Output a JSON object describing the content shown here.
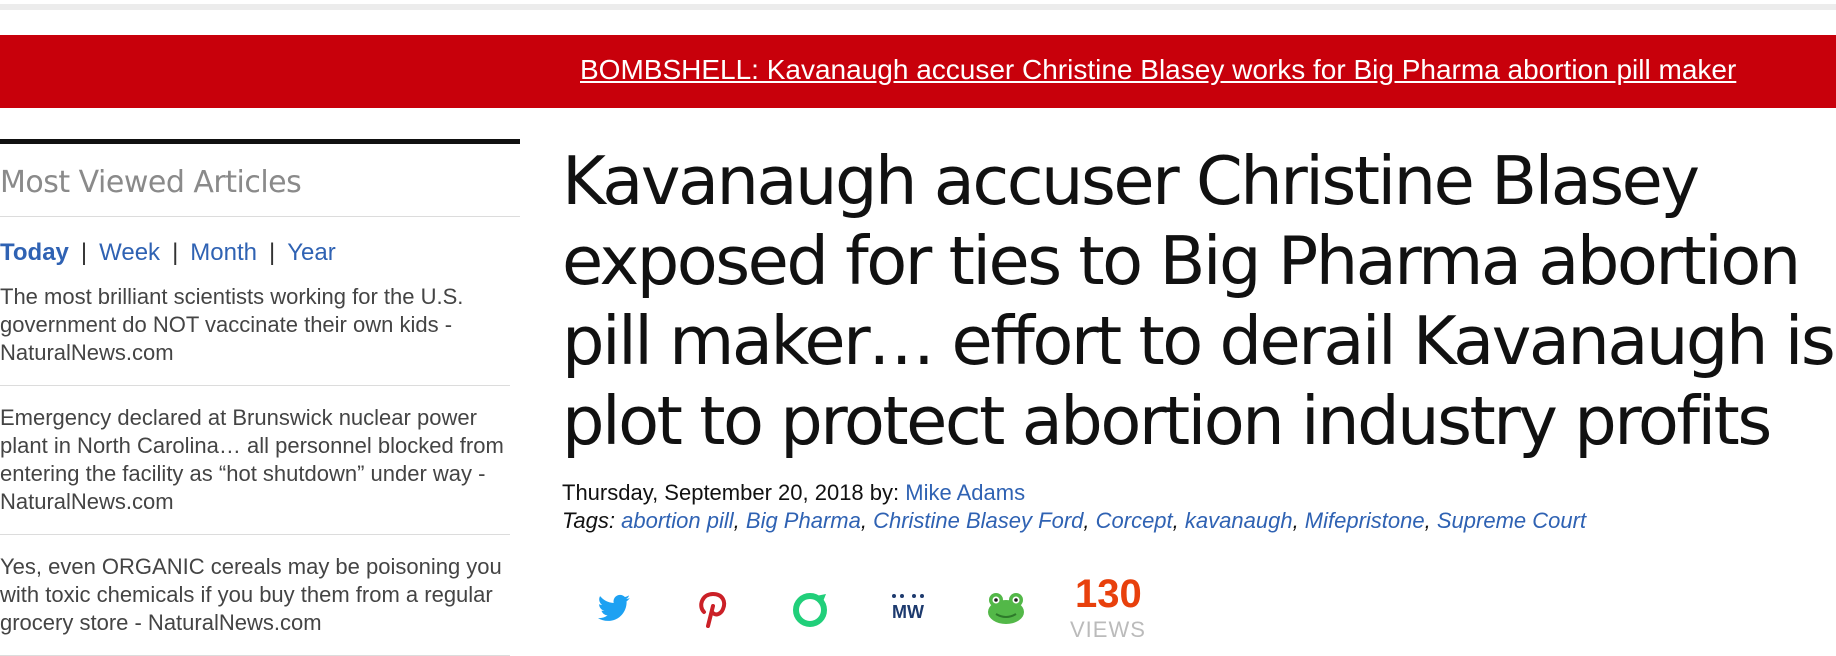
{
  "banner": {
    "text": "BOMBSHELL: Kavanaugh accuser Christine Blasey works for Big Pharma abortion pill maker"
  },
  "sidebar": {
    "title": "Most Viewed Articles",
    "tabs": [
      {
        "label": "Today",
        "active": true
      },
      {
        "label": "Week",
        "active": false
      },
      {
        "label": "Month",
        "active": false
      },
      {
        "label": "Year",
        "active": false
      }
    ],
    "items": [
      {
        "text": "The most brilliant scientists working for the U.S. government do NOT vaccinate their own kids - NaturalNews.com"
      },
      {
        "text": "Emergency declared at Brunswick nuclear power plant in North Carolina… all personnel blocked from entering the facility as “hot shutdown” under way - NaturalNews.com"
      },
      {
        "text": "Yes, even ORGANIC cereals may be poisoning you with toxic chemicals if you buy them from a regular grocery store - NaturalNews.com"
      }
    ]
  },
  "article": {
    "headline": "Kavanaugh accuser Christine Blasey exposed for ties to Big Pharma abortion pill maker… effort to derail Kavanaugh is plot to protect abortion industry profits",
    "date": "Thursday, September 20, 2018",
    "by_label": "by:",
    "author": "Mike Adams",
    "tags_label": "Tags:",
    "tags": [
      "abortion pill",
      "Big Pharma",
      "Christine Blasey Ford",
      "Corcept",
      "kavanaugh",
      "Mifepristone",
      "Supreme Court"
    ]
  },
  "share": {
    "icons": [
      "twitter-icon",
      "pinterest-icon",
      "gab-icon",
      "mewe-icon",
      "frog-icon"
    ],
    "views_count": "130",
    "views_label": "VIEWS",
    "colors": {
      "twitter": "#1da1f2",
      "pinterest": "#cb2027",
      "gab": "#21cf7a",
      "mewe": "#1d3a6e",
      "frog": "#53b848"
    }
  },
  "colors": {
    "banner_bg": "#c8000b",
    "link": "#2f62b3",
    "views": "#e8400c"
  }
}
